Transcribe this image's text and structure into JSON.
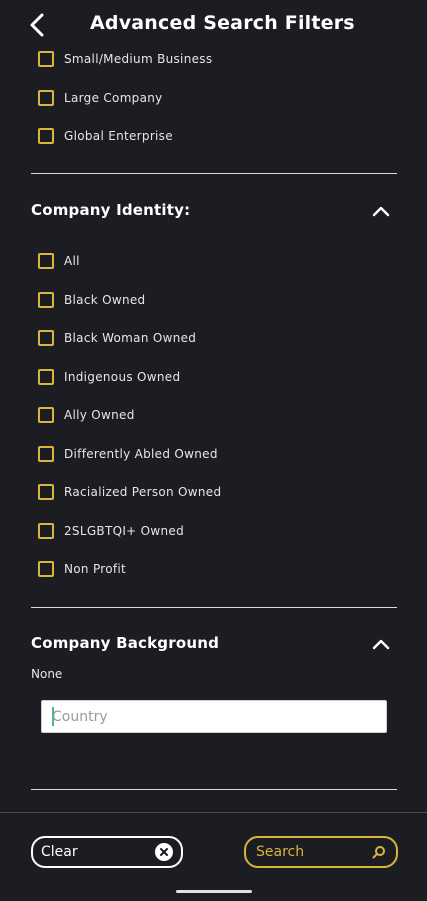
{
  "header": {
    "title": "Advanced Search Filters",
    "back_icon": "chevron-left-icon"
  },
  "company_size": {
    "items": [
      {
        "label": "Small/Medium Business",
        "checked": false
      },
      {
        "label": "Large Company",
        "checked": false
      },
      {
        "label": "Global Enterprise",
        "checked": false
      }
    ]
  },
  "company_identity": {
    "title": "Company Identity:",
    "expanded_icon": "chevron-up-icon",
    "items": [
      {
        "label": "All",
        "checked": false
      },
      {
        "label": "Black Owned",
        "checked": false
      },
      {
        "label": "Black Woman Owned",
        "checked": false
      },
      {
        "label": "Indigenous Owned",
        "checked": false
      },
      {
        "label": "Ally Owned",
        "checked": false
      },
      {
        "label": "Differently Abled Owned",
        "checked": false
      },
      {
        "label": "Racialized Person Owned",
        "checked": false
      },
      {
        "label": "2SLGBTQI+ Owned",
        "checked": false
      },
      {
        "label": "Non Profit",
        "checked": false
      }
    ]
  },
  "company_background": {
    "title": "Company Background",
    "expanded_icon": "chevron-up-icon",
    "selected_text": "None",
    "country": {
      "value": "",
      "placeholder": "Country"
    }
  },
  "footer": {
    "clear_label": "Clear",
    "search_label": "Search",
    "clear_icon": "close-circle-icon",
    "search_icon": "search-icon"
  },
  "colors": {
    "background": "#1b1d23",
    "accent": "#d9b53b",
    "text": "#ffffff"
  }
}
